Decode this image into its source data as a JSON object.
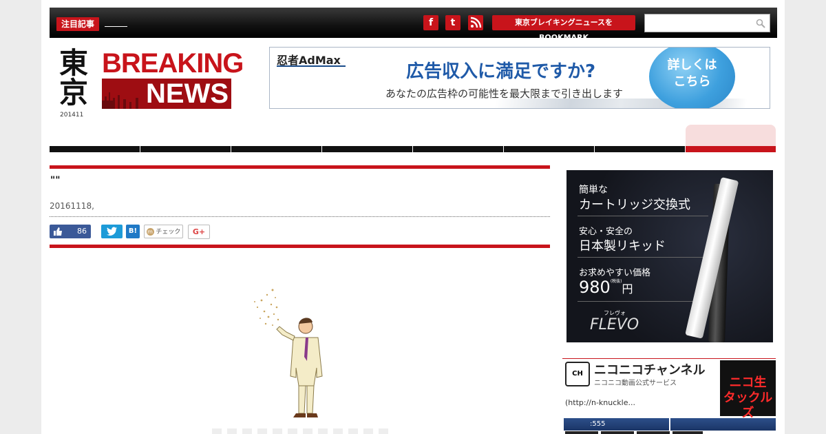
{
  "header": {
    "pickup_label": "注目記事",
    "bookmark_label": "東京ブレイキングニュースをBOOKMARK",
    "search_placeholder": ""
  },
  "logo": {
    "kanji_top": "東",
    "kanji_bottom": "京",
    "line1": "BREAKING",
    "line2": "NEWS",
    "date": "201411"
  },
  "banner": {
    "brand": "忍者AdMax",
    "headline": "広告収入に満足ですか?",
    "sub": "あなたの広告枠の可能性を最大限まで引き出します",
    "cta": "詳しくは\nこちら"
  },
  "article": {
    "title": "\"\"",
    "date": "20161118,",
    "like_count": "86",
    "hatena_label": "B!",
    "mixi_label": "チェック",
    "gplus_label": "G+"
  },
  "sidebar_ad": {
    "l1": "簡単な",
    "l2": "カートリッジ交換式",
    "l3": "安心・安全の",
    "l4": "日本製リキッド",
    "l5": "お求めやすい価格",
    "price": "980",
    "tax": "(税抜)",
    "yen": "円",
    "brand_kana": "フレヴォ",
    "brand": "FLEVO"
  },
  "nico": {
    "title": "ニコニコチャンネル",
    "sub": "ニコニコ動画公式サービス",
    "link": "(http://n-knuckle...",
    "thumb_text": "ニコ生\nタックルズ",
    "btn1": ":555",
    "btn2": ""
  },
  "colors": {
    "accent": "#c8141b",
    "nav": "#111111"
  }
}
